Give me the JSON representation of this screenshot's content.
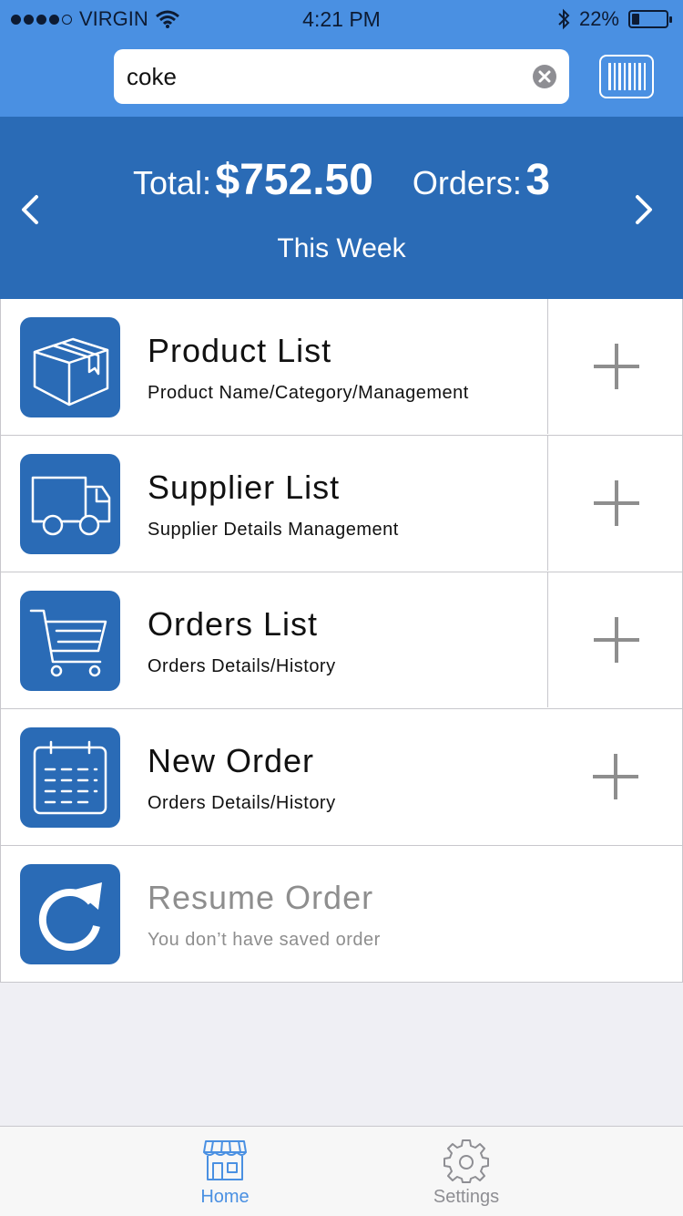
{
  "status_bar": {
    "carrier": "VIRGIN",
    "time": "4:21 PM",
    "battery": "22%",
    "battery_level": 0.22,
    "signal_bars": 4,
    "signal_max": 5
  },
  "search": {
    "value": "coke",
    "clear_icon": "clear-x-icon",
    "barcode_icon": "barcode-icon"
  },
  "summary": {
    "total_label": "Total:",
    "total_value": "$752.50",
    "orders_label": "Orders:",
    "orders_value": "3",
    "period": "This Week"
  },
  "menu": [
    {
      "title": "Product List",
      "subtitle": "Product Name/Category/Management",
      "icon": "box-icon",
      "enabled": true,
      "has_add": true
    },
    {
      "title": "Supplier List",
      "subtitle": "Supplier Details Management",
      "icon": "truck-icon",
      "enabled": true,
      "has_add": true
    },
    {
      "title": "Orders List",
      "subtitle": "Orders Details/History",
      "icon": "cart-icon",
      "enabled": true,
      "has_add": true
    },
    {
      "title": "New Order",
      "subtitle": "Orders Details/History",
      "icon": "calendar-icon",
      "enabled": true,
      "has_add": true
    },
    {
      "title": "Resume Order",
      "subtitle": "You don’t have saved order",
      "icon": "redo-icon",
      "enabled": false,
      "has_add": false
    }
  ],
  "tabs": [
    {
      "label": "Home",
      "icon": "store-icon",
      "active": true
    },
    {
      "label": "Settings",
      "icon": "gear-icon",
      "active": false
    }
  ],
  "colors": {
    "header_blue": "#4a90e2",
    "banner_blue": "#2a6bb6",
    "tile_blue": "#2a6bb6",
    "background": "#efeff4",
    "disabled_text": "#8e8e8e",
    "inactive_tab": "#8e8e93"
  }
}
